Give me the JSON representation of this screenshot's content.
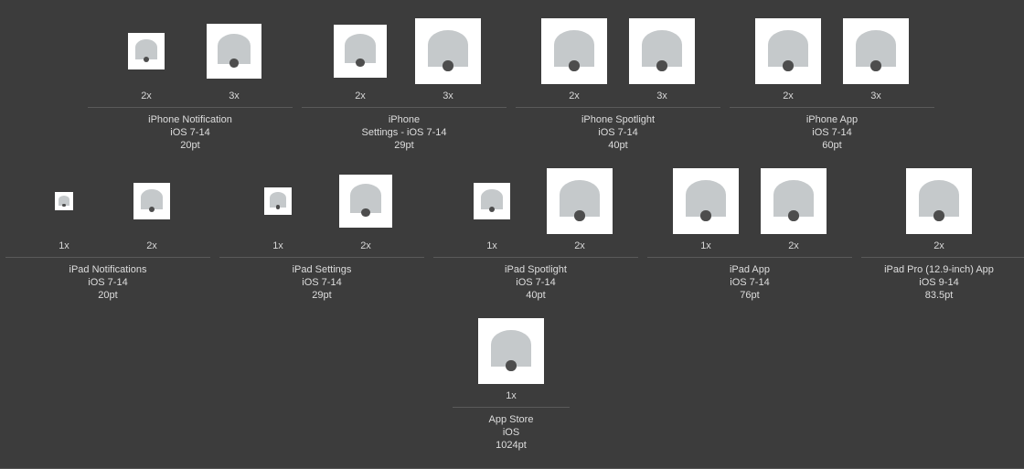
{
  "groups": [
    {
      "id": "iphone-notification",
      "lines": [
        "iPhone Notification",
        "iOS 7-14",
        "20pt"
      ],
      "scales": [
        "2x",
        "3x"
      ]
    },
    {
      "id": "iphone-settings",
      "lines": [
        "iPhone",
        "Settings - iOS 7-14",
        "29pt"
      ],
      "scales": [
        "2x",
        "3x"
      ]
    },
    {
      "id": "iphone-spotlight",
      "lines": [
        "iPhone Spotlight",
        "iOS 7-14",
        "40pt"
      ],
      "scales": [
        "2x",
        "3x"
      ]
    },
    {
      "id": "iphone-app",
      "lines": [
        "iPhone App",
        "iOS 7-14",
        "60pt"
      ],
      "scales": [
        "2x",
        "3x"
      ]
    },
    {
      "id": "ipad-notifications",
      "lines": [
        "iPad Notifications",
        "iOS 7-14",
        "20pt"
      ],
      "scales": [
        "1x",
        "2x"
      ]
    },
    {
      "id": "ipad-settings",
      "lines": [
        "iPad Settings",
        "iOS 7-14",
        "29pt"
      ],
      "scales": [
        "1x",
        "2x"
      ]
    },
    {
      "id": "ipad-spotlight",
      "lines": [
        "iPad Spotlight",
        "iOS 7-14",
        "40pt"
      ],
      "scales": [
        "1x",
        "2x"
      ]
    },
    {
      "id": "ipad-app",
      "lines": [
        "iPad App",
        "iOS 7-14",
        "76pt"
      ],
      "scales": [
        "1x",
        "2x"
      ]
    },
    {
      "id": "ipad-pro-app",
      "lines": [
        "iPad Pro (12.9-inch) App",
        "iOS 9-14",
        "83.5pt"
      ],
      "scales": [
        "2x"
      ]
    },
    {
      "id": "app-store",
      "lines": [
        "App Store",
        "iOS",
        "1024pt"
      ],
      "scales": [
        "1x"
      ]
    }
  ],
  "icon_name": "bell-icon",
  "colors": {
    "background": "#3c3c3c",
    "slot": "#ffffff",
    "bell": "#c5c9cb",
    "clapper": "#4d4d4d"
  }
}
